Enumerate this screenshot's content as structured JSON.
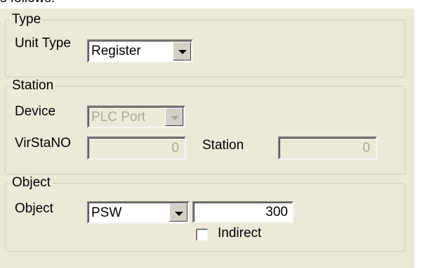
{
  "cropped_top_text": "s follows:",
  "type_group": {
    "title": "Type",
    "unit_type_label": "Unit Type",
    "unit_type_value": "Register"
  },
  "station_group": {
    "title": "Station",
    "device_label": "Device",
    "device_value": "PLC Port",
    "virstano_label": "VirStaNO",
    "virstano_value": "0",
    "station_label": "Station",
    "station_value": "0"
  },
  "object_group": {
    "title": "Object",
    "object_label": "Object",
    "object_type_value": "PSW",
    "object_address_value": "300",
    "indirect_label": "Indirect",
    "indirect_checked": false
  },
  "icons": {
    "dropdown": "chevron-down-icon"
  }
}
